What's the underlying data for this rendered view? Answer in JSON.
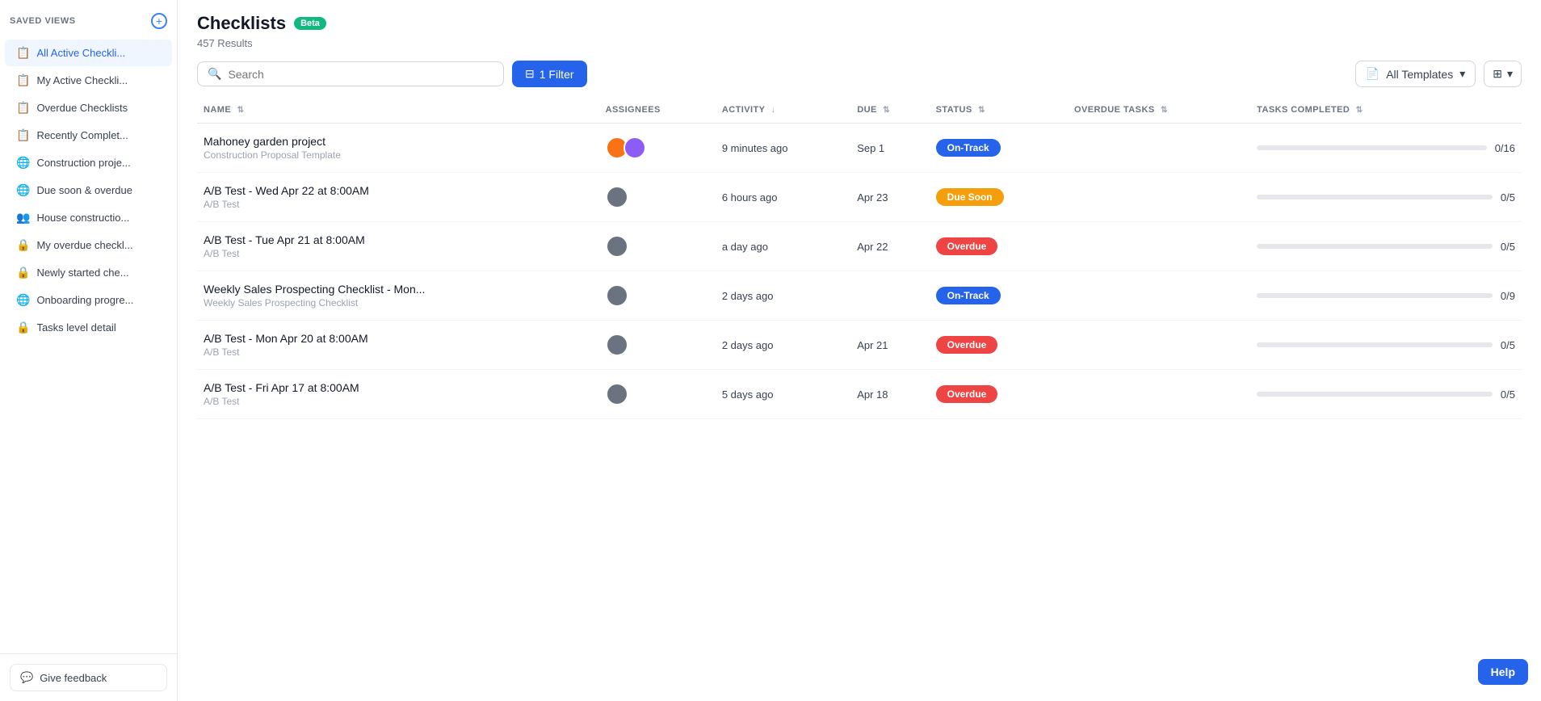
{
  "sidebar": {
    "header": "Saved Views",
    "add_tooltip": "Add",
    "items": [
      {
        "id": "all-active",
        "label": "All Active Checkli...",
        "icon": "📋",
        "active": true
      },
      {
        "id": "my-active",
        "label": "My Active Checkli...",
        "icon": "📋",
        "active": false
      },
      {
        "id": "overdue",
        "label": "Overdue Checklists",
        "icon": "📋",
        "active": false
      },
      {
        "id": "recently",
        "label": "Recently Complet...",
        "icon": "📋",
        "active": false
      },
      {
        "id": "construction",
        "label": "Construction proje...",
        "icon": "🌐",
        "active": false
      },
      {
        "id": "due-soon",
        "label": "Due soon & overdue",
        "icon": "🌐",
        "active": false
      },
      {
        "id": "house",
        "label": "House constructio...",
        "icon": "👥",
        "active": false
      },
      {
        "id": "my-overdue",
        "label": "My overdue checkl...",
        "icon": "🔒",
        "active": false
      },
      {
        "id": "newly-started",
        "label": "Newly started che...",
        "icon": "🔒",
        "active": false
      },
      {
        "id": "onboarding",
        "label": "Onboarding progre...",
        "icon": "🌐",
        "active": false
      },
      {
        "id": "tasks-level",
        "label": "Tasks level detail",
        "icon": "🔒",
        "active": false
      }
    ],
    "feedback_label": "Give feedback"
  },
  "header": {
    "title": "Checklists",
    "beta_label": "Beta",
    "result_count": "457 Results"
  },
  "toolbar": {
    "search_placeholder": "Search",
    "filter_label": "1 Filter",
    "templates_label": "All Templates",
    "view_icon": "grid"
  },
  "table": {
    "columns": [
      {
        "id": "name",
        "label": "NAME",
        "sortable": true
      },
      {
        "id": "assignees",
        "label": "ASSIGNEES",
        "sortable": false
      },
      {
        "id": "activity",
        "label": "ACTIVITY",
        "sortable": true
      },
      {
        "id": "due",
        "label": "DUE",
        "sortable": true
      },
      {
        "id": "status",
        "label": "STATUS",
        "sortable": true
      },
      {
        "id": "overdue_tasks",
        "label": "OVERDUE TASKS",
        "sortable": true
      },
      {
        "id": "tasks_completed",
        "label": "TASKS COMPLETED",
        "sortable": true
      }
    ],
    "rows": [
      {
        "id": 1,
        "name": "Mahoney garden project",
        "template": "Construction Proposal Template",
        "assignees": [
          "orange",
          "purple"
        ],
        "activity": "9 minutes ago",
        "due": "Sep 1",
        "status": "On-Track",
        "status_class": "status-ontrack",
        "overdue_tasks": "",
        "progress": 0,
        "progress_total": 16,
        "progress_label": "0/16",
        "progress_color": "progress-blue"
      },
      {
        "id": 2,
        "name": "A/B Test - Wed Apr 22 at 8:00AM",
        "template": "A/B Test",
        "assignees": [
          "gray"
        ],
        "activity": "6 hours ago",
        "due": "Apr 23",
        "status": "Due Soon",
        "status_class": "status-duesoon",
        "overdue_tasks": "",
        "progress": 0,
        "progress_total": 5,
        "progress_label": "0/5",
        "progress_color": "progress-yellow"
      },
      {
        "id": 3,
        "name": "A/B Test - Tue Apr 21 at 8:00AM",
        "template": "A/B Test",
        "assignees": [
          "gray"
        ],
        "activity": "a day ago",
        "due": "Apr 22",
        "status": "Overdue",
        "status_class": "status-overdue",
        "overdue_tasks": "",
        "progress": 0,
        "progress_total": 5,
        "progress_label": "0/5",
        "progress_color": "progress-red"
      },
      {
        "id": 4,
        "name": "Weekly Sales Prospecting Checklist - Mon...",
        "template": "Weekly Sales Prospecting Checklist",
        "assignees": [
          "gray"
        ],
        "activity": "2 days ago",
        "due": "",
        "status": "On-Track",
        "status_class": "status-ontrack",
        "overdue_tasks": "",
        "progress": 0,
        "progress_total": 9,
        "progress_label": "0/9",
        "progress_color": "progress-blue"
      },
      {
        "id": 5,
        "name": "A/B Test - Mon Apr 20 at 8:00AM",
        "template": "A/B Test",
        "assignees": [
          "gray"
        ],
        "activity": "2 days ago",
        "due": "Apr 21",
        "status": "Overdue",
        "status_class": "status-overdue",
        "overdue_tasks": "",
        "progress": 0,
        "progress_total": 5,
        "progress_label": "0/5",
        "progress_color": "progress-red"
      },
      {
        "id": 6,
        "name": "A/B Test - Fri Apr 17 at 8:00AM",
        "template": "A/B Test",
        "assignees": [
          "gray"
        ],
        "activity": "5 days ago",
        "due": "Apr 18",
        "status": "Overdue",
        "status_class": "status-overdue",
        "overdue_tasks": "",
        "progress": 0,
        "progress_total": 5,
        "progress_label": "0/5",
        "progress_color": "progress-red"
      }
    ]
  },
  "help_label": "Help"
}
